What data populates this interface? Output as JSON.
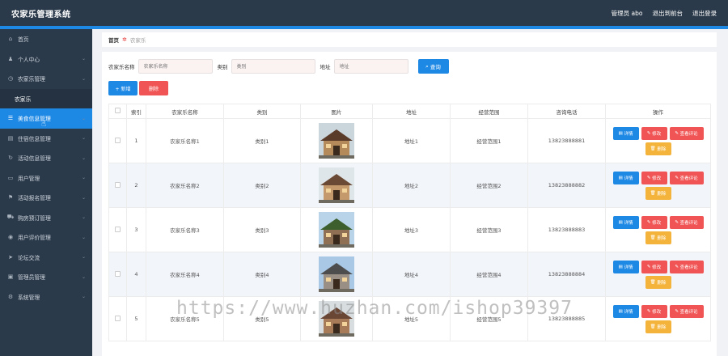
{
  "header": {
    "title": "农家乐管理系统",
    "admin_label": "管理员 abo",
    "to_frontend": "退出到前台",
    "logout": "退出登录"
  },
  "sidebar": {
    "items": [
      {
        "label": "首页",
        "icon": "home-icon",
        "has_children": false
      },
      {
        "label": "个人中心",
        "icon": "user-icon",
        "has_children": true
      },
      {
        "label": "农家乐管理",
        "icon": "clock-icon",
        "has_children": true
      },
      {
        "label": "农家乐",
        "icon": "",
        "has_children": false,
        "sub": true
      },
      {
        "label": "美食信息管理",
        "icon": "list-icon",
        "has_children": true,
        "active": true
      },
      {
        "label": "住宿信息管理",
        "icon": "bed-icon",
        "has_children": true
      },
      {
        "label": "活动信息管理",
        "icon": "refresh-icon",
        "has_children": true
      },
      {
        "label": "用户管理",
        "icon": "folder-icon",
        "has_children": true
      },
      {
        "label": "活动报名管理",
        "icon": "flag-icon",
        "has_children": true
      },
      {
        "label": "购房预订管理",
        "icon": "cart-icon",
        "has_children": true
      },
      {
        "label": "用户评价管理",
        "icon": "user-circle-icon",
        "has_children": true
      },
      {
        "label": "论坛交流",
        "icon": "send-icon",
        "has_children": true
      },
      {
        "label": "管理员管理",
        "icon": "briefcase-icon",
        "has_children": true
      },
      {
        "label": "系统管理",
        "icon": "gear-icon",
        "has_children": true
      }
    ]
  },
  "breadcrumb": {
    "home": "首页",
    "current": "农家乐"
  },
  "search": {
    "name_label": "农家乐名称",
    "name_placeholder": "农家乐名称",
    "type_label": "类别",
    "type_placeholder": "类别",
    "address_label": "地址",
    "address_placeholder": "地址",
    "query_button": "查询"
  },
  "actions": {
    "add": "+ 新增",
    "delete": "删除"
  },
  "table": {
    "columns": [
      "",
      "索引",
      "农家乐名称",
      "类别",
      "图片",
      "地址",
      "经营范围",
      "咨询电话",
      "操作"
    ],
    "op_labels": {
      "detail": "详情",
      "edit": "修改",
      "review": "查看评论",
      "delete": "删除"
    },
    "rows": [
      {
        "index": "1",
        "name": "农家乐名称1",
        "type": "类别1",
        "address": "地址1",
        "scope": "经营范围1",
        "phone": "13823888881"
      },
      {
        "index": "2",
        "name": "农家乐名称2",
        "type": "类别2",
        "address": "地址2",
        "scope": "经营范围2",
        "phone": "13823888882"
      },
      {
        "index": "3",
        "name": "农家乐名称3",
        "type": "类别3",
        "address": "地址3",
        "scope": "经营范围3",
        "phone": "13823888883"
      },
      {
        "index": "4",
        "name": "农家乐名称4",
        "type": "类别4",
        "address": "地址4",
        "scope": "经营范围4",
        "phone": "13823888884"
      },
      {
        "index": "5",
        "name": "农家乐名称5",
        "type": "类别5",
        "address": "地址5",
        "scope": "经营范围5",
        "phone": "13823888885"
      }
    ]
  },
  "watermark": "https://www.huzhan.com/ishop39397",
  "colors": {
    "sidebar_bg": "#2b3a4a",
    "accent": "#1e88e5",
    "danger": "#f05454",
    "warning": "#f4b43c"
  }
}
